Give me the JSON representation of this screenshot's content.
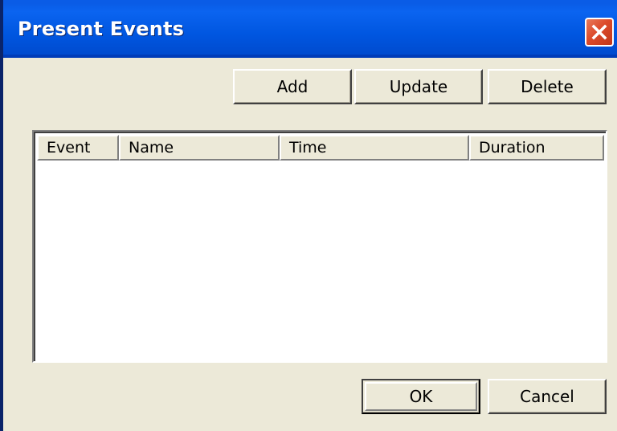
{
  "window": {
    "title": "Present Events"
  },
  "toolbar": {
    "add_label": "Add",
    "update_label": "Update",
    "delete_label": "Delete"
  },
  "list": {
    "columns": [
      "Event",
      "Name",
      "Time",
      "Duration"
    ],
    "rows": []
  },
  "footer": {
    "ok_label": "OK",
    "cancel_label": "Cancel"
  },
  "icons": {
    "close": "close-icon"
  },
  "colors": {
    "titlebar": "#0058e6",
    "close_button": "#dc4a2a",
    "dialog_background": "#ece9d8"
  }
}
